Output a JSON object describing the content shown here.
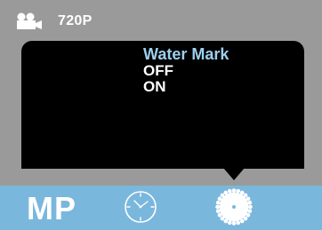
{
  "status_bar": {
    "mode_icon": "video-camera-icon",
    "resolution": "720P"
  },
  "menu": {
    "title": "Water Mark",
    "options": [
      "OFF",
      "ON"
    ]
  },
  "mode_bar": {
    "items": [
      {
        "label": "MP",
        "icon": "megapixel-text"
      },
      {
        "label": "",
        "icon": "clock-icon"
      },
      {
        "label": "",
        "icon": "settings-gear-icon"
      }
    ],
    "selected_index": 2
  },
  "colors": {
    "background": "#9a9a9a",
    "menu_bg": "#000000",
    "title_color": "#9dd0ee",
    "option_color": "#ffffff",
    "mode_bar_bg": "#7ab7dd"
  }
}
